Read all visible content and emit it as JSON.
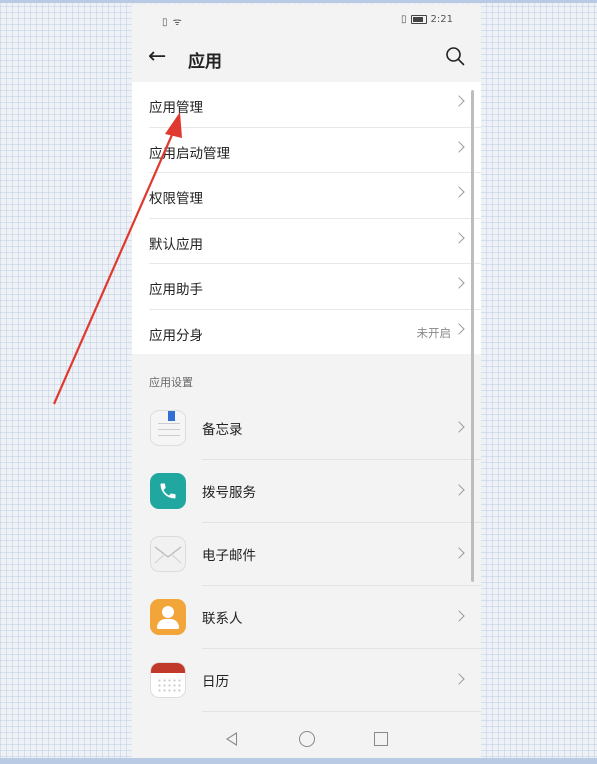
{
  "status_bar": {
    "time": "2:21"
  },
  "header": {
    "title": "应用"
  },
  "main_list": [
    {
      "label": "应用管理",
      "value": ""
    },
    {
      "label": "应用启动管理",
      "value": ""
    },
    {
      "label": "权限管理",
      "value": ""
    },
    {
      "label": "默认应用",
      "value": ""
    },
    {
      "label": "应用助手",
      "value": ""
    },
    {
      "label": "应用分身",
      "value": "未开启"
    }
  ],
  "app_settings": {
    "section_title": "应用设置",
    "apps": [
      {
        "label": "备忘录",
        "icon": "memo-icon"
      },
      {
        "label": "拨号服务",
        "icon": "phone-icon"
      },
      {
        "label": "电子邮件",
        "icon": "mail-icon"
      },
      {
        "label": "联系人",
        "icon": "contact-icon"
      },
      {
        "label": "日历",
        "icon": "calendar-icon"
      }
    ]
  },
  "colors": {
    "annotation_arrow": "#e0392f",
    "phone_icon_bg": "#20a8a0",
    "contact_icon_bg": "#f2a63a",
    "calendar_icon_top": "#c0392b",
    "memo_tag": "#2f6fd6"
  }
}
